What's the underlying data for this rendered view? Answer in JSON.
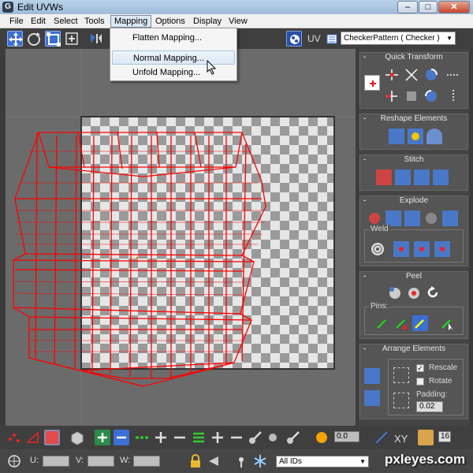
{
  "window": {
    "title": "Edit UVWs",
    "app_icon": "3ds-max-icon"
  },
  "menu": {
    "items": [
      "File",
      "Edit",
      "Select",
      "Tools",
      "Mapping",
      "Options",
      "Display",
      "View"
    ],
    "open_menu": "Mapping",
    "dropdown": [
      "Flatten Mapping...",
      "Normal Mapping...",
      "Unfold Mapping..."
    ],
    "highlighted": "Normal Mapping..."
  },
  "toolbar": {
    "uv_label": "UV",
    "texture_select": "CheckerPattern  ( Checker )",
    "icons": [
      "move-icon",
      "rotate-icon",
      "scale-icon",
      "freeform-icon",
      "mirror-icon",
      "show-map-icon",
      "coordinate-icon"
    ]
  },
  "panel": {
    "quick_transform": {
      "title": "Quick Transform",
      "toggle": "-"
    },
    "reshape": {
      "title": "Reshape Elements",
      "toggle": "-"
    },
    "stitch": {
      "title": "Stitch",
      "toggle": "-"
    },
    "explode": {
      "title": "Explode",
      "toggle": "-",
      "weld_label": "Weld"
    },
    "peel": {
      "title": "Peel",
      "toggle": "-",
      "pins_label": "Pins:"
    },
    "arrange": {
      "title": "Arrange Elements",
      "toggle": "-",
      "rescale_label": "Rescale",
      "rescale_checked": true,
      "rotate_label": "Rotate",
      "rotate_checked": false,
      "padding_label": "Padding:",
      "padding_value": "0.02"
    }
  },
  "bottom": {
    "spinner_value": "0.0",
    "xy_label": "XY",
    "zoom_value": "16",
    "u_label": "U:",
    "v_label": "V:",
    "w_label": "W:",
    "ids_select": "All IDs"
  },
  "watermark": "pxleyes.com",
  "colors": {
    "wireframe": "#ff0000",
    "viewport_bg": "#6b6b6b",
    "panel_bg": "#555555",
    "accent": "#3b6fd4"
  }
}
